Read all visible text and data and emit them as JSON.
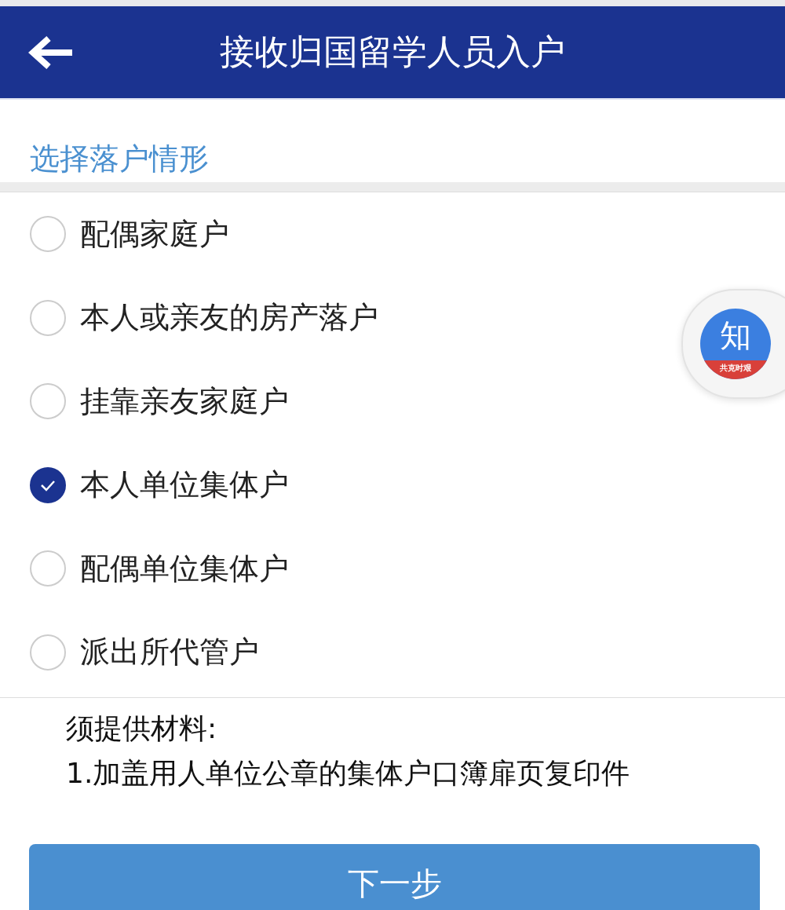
{
  "header": {
    "title": "接收归国留学人员入户"
  },
  "section_title": "选择落户情形",
  "options": [
    {
      "label": "配偶家庭户",
      "selected": false
    },
    {
      "label": "本人或亲友的房产落户",
      "selected": false
    },
    {
      "label": "挂靠亲友家庭户",
      "selected": false
    },
    {
      "label": "本人单位集体户",
      "selected": true
    },
    {
      "label": "配偶单位集体户",
      "selected": false
    },
    {
      "label": "派出所代管户",
      "selected": false
    }
  ],
  "materials": {
    "heading": "须提供材料:",
    "items": [
      "1.加盖用人单位公章的集体户口簿扉页复印件"
    ]
  },
  "floating_button": {
    "glyph": "知",
    "banner": "共克时艰"
  },
  "next_button": "下一步"
}
